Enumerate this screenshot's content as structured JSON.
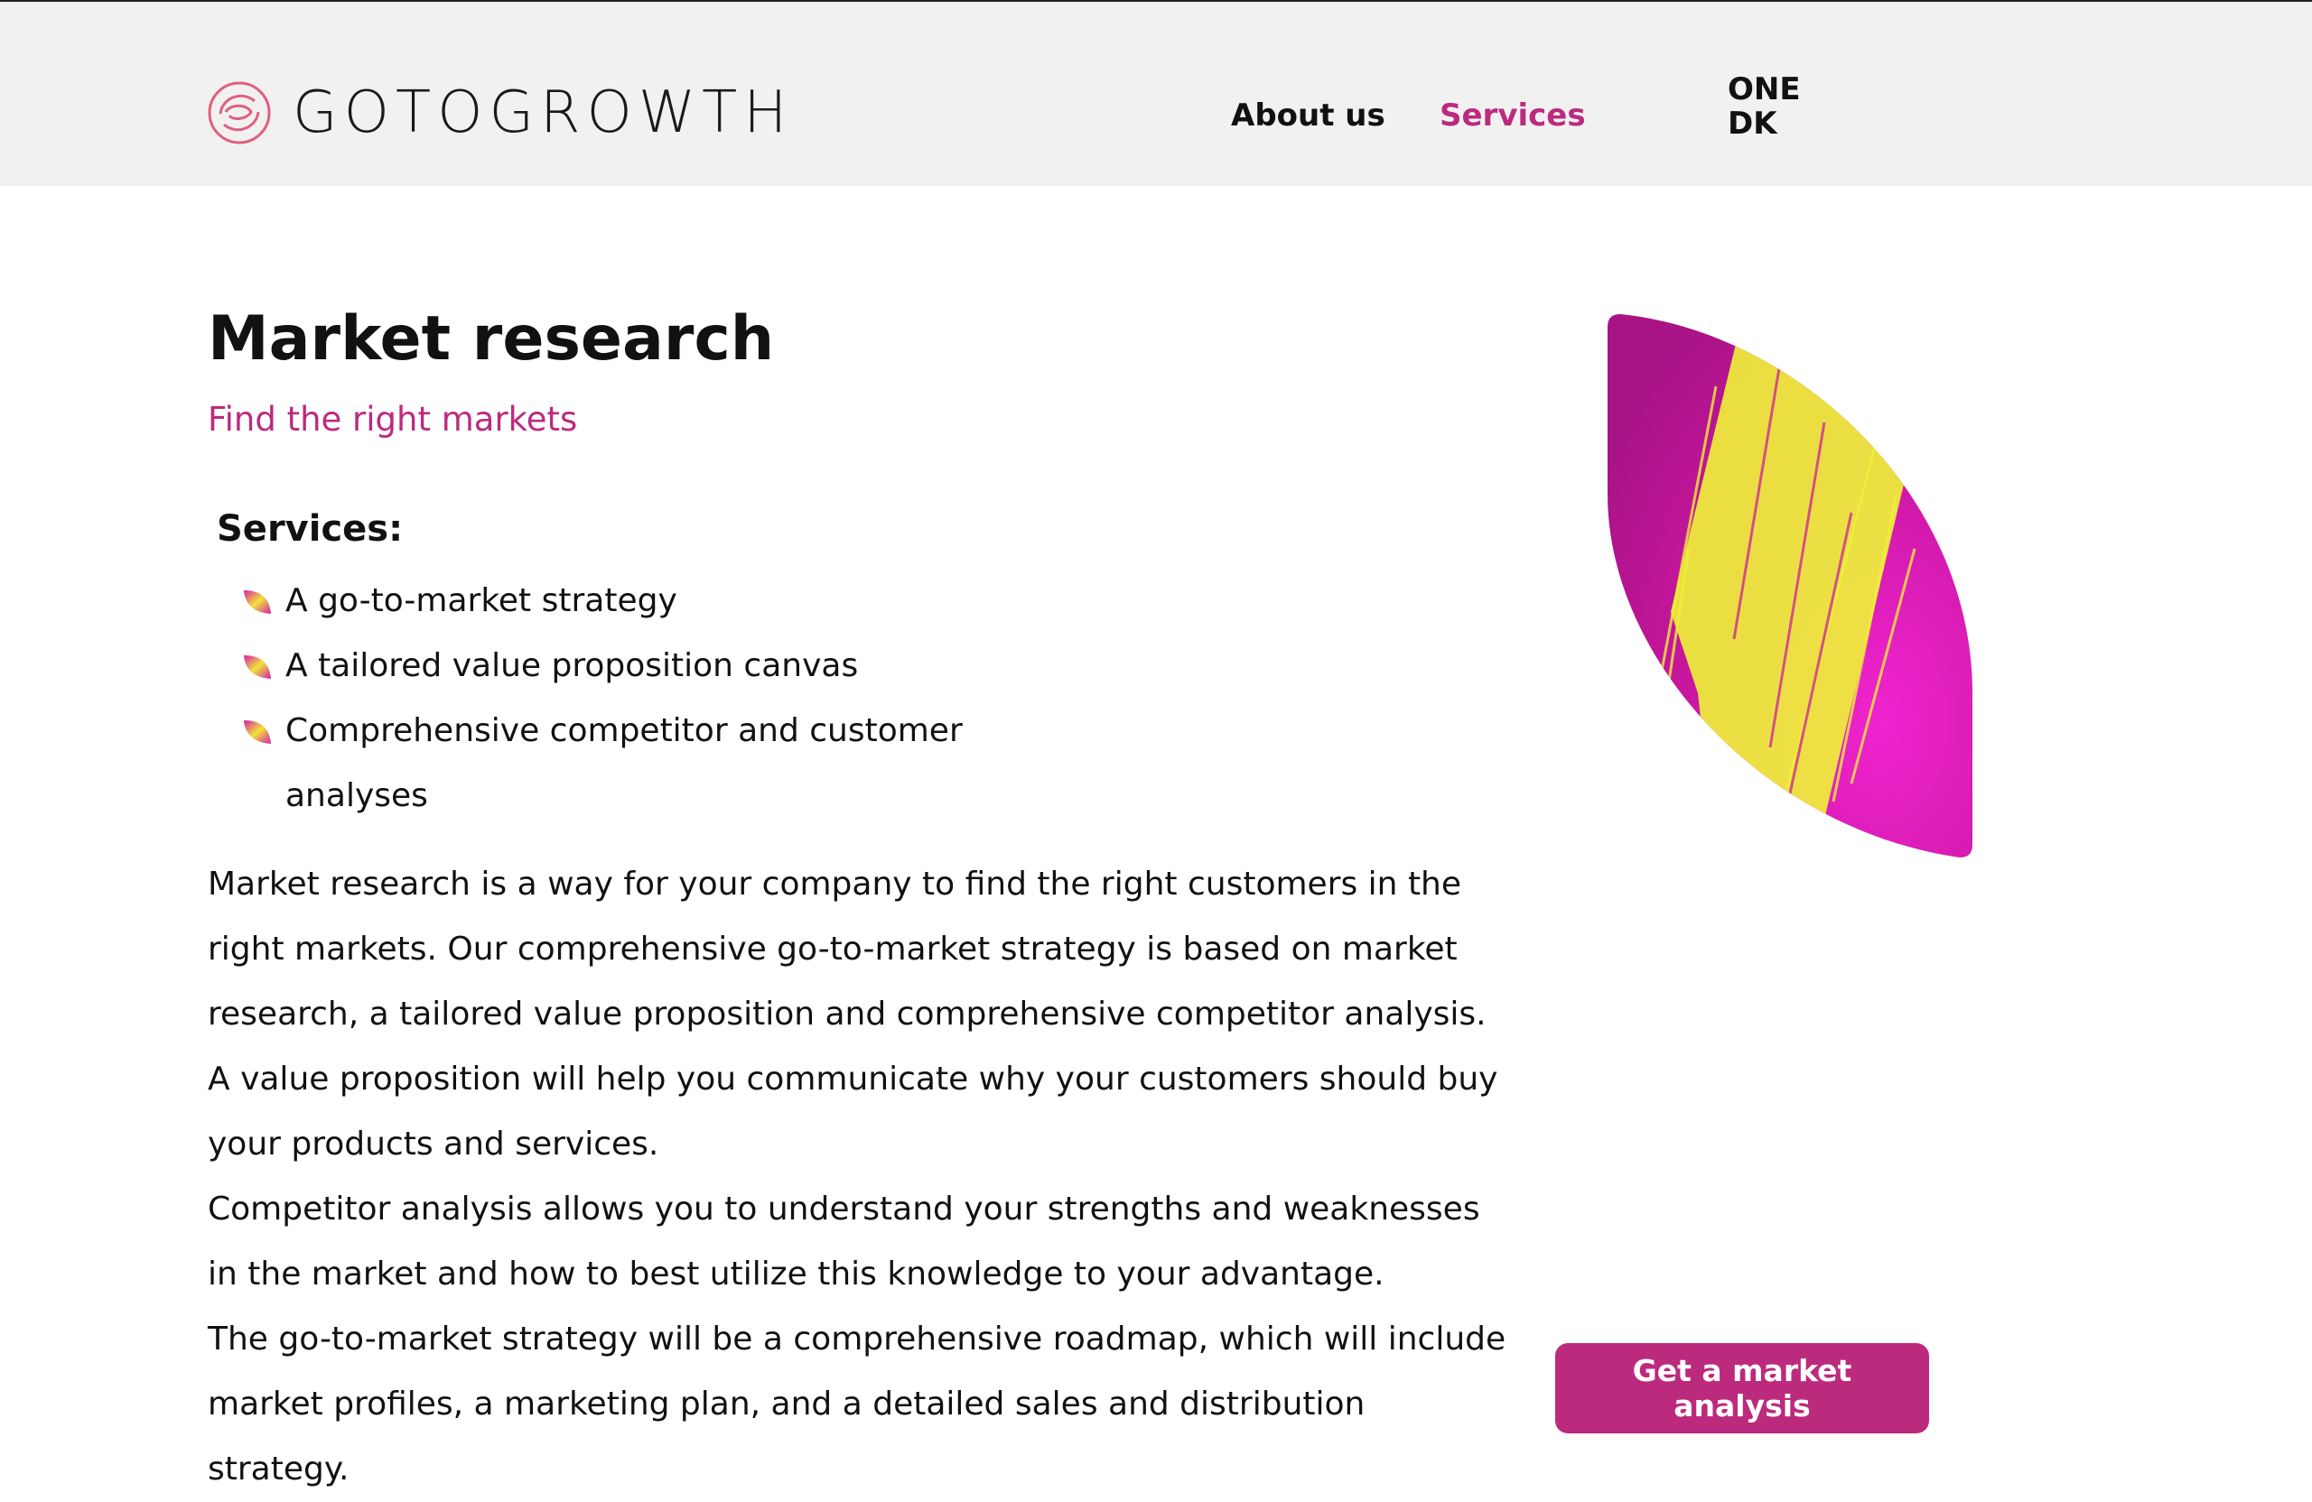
{
  "header": {
    "logo_text": "GOTOGROWTH",
    "nav": {
      "about": "About us",
      "services": "Services",
      "lang_line1": "ONE",
      "lang_line2": "DK"
    }
  },
  "main": {
    "title": "Market research",
    "subtitle": "Find the right markets",
    "services_heading": "Services:",
    "services": [
      "A go-to-market strategy",
      "A tailored value proposition canvas",
      "Comprehensive competitor and customer analyses"
    ],
    "paragraphs": [
      "Market research is a way for your company to find the right customers in the right markets. Our comprehensive go-to-market strategy is based on market research, a tailored value proposition and comprehensive competitor analysis.",
      "A value proposition will help you communicate why your customers should buy your products and services.",
      "Competitor analysis allows you to understand your strengths and weaknesses in the market and how to best utilize this knowledge to your advantage.",
      "The go-to-market strategy will be a comprehensive roadmap, which will include market profiles, a marketing plan, and a detailed sales and distribution strategy."
    ],
    "cta_label": "Get a market analysis"
  },
  "colors": {
    "accent": "#bc2a7e",
    "header_bg": "#f1f1f1",
    "leaf_magenta": "#e01fb8",
    "leaf_yellow": "#eef03a"
  },
  "icons": {
    "logo": "spiral-logo-icon",
    "bullet": "leaf-bullet-icon",
    "hero": "leaf-image"
  }
}
